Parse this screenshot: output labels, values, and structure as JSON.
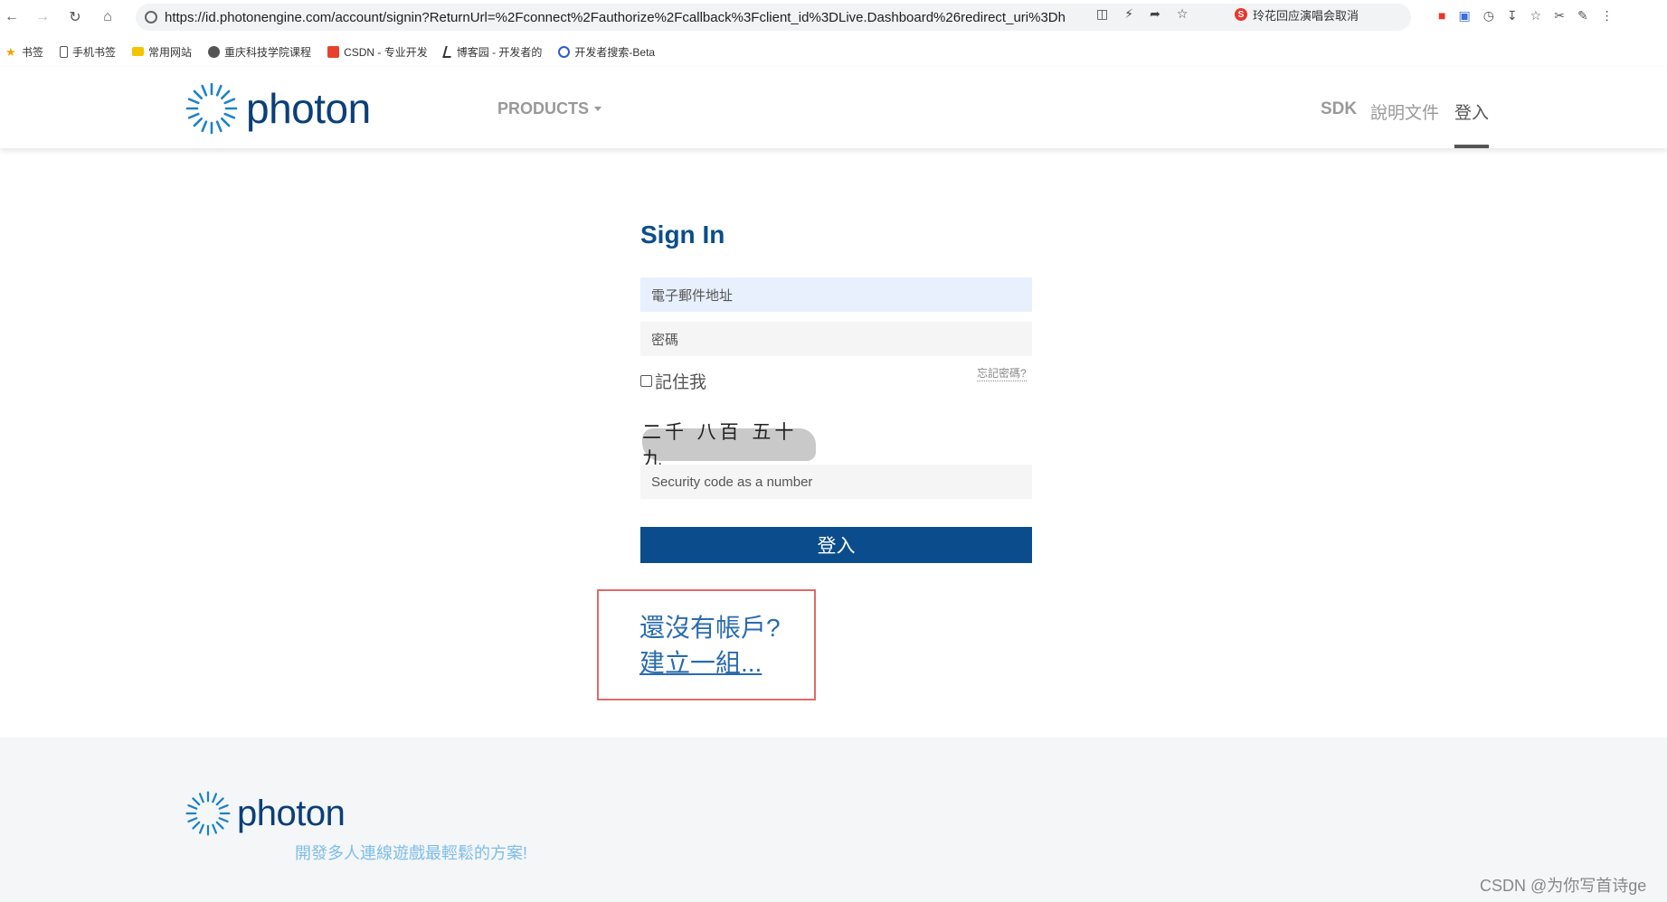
{
  "browser": {
    "url": "https://id.photonengine.com/account/signin?ReturnUrl=%2Fconnect%2Fauthorize%2Fcallback%3Fclient_id%3DLive.Dashboard%26redirect_uri%3Dh",
    "news_chip": "玲花回应演唱会取消",
    "bookmarks": [
      {
        "label": "书签",
        "icon": "star-icon"
      },
      {
        "label": "手机书签",
        "icon": "phone-icon"
      },
      {
        "label": "常用网站",
        "icon": "folder-icon"
      },
      {
        "label": "重庆科技学院课程",
        "icon": "globe-icon"
      },
      {
        "label": "CSDN - 专业开发",
        "icon": "csdn-icon"
      },
      {
        "label": "博客园 - 开发者的",
        "icon": "cnblogs-icon"
      },
      {
        "label": "开发者搜索-Beta",
        "icon": "search-beta-icon"
      }
    ]
  },
  "header": {
    "logo_text": "photon",
    "products_label": "PRODUCTS",
    "sdk_label": "SDK",
    "docs_label": "說明文件",
    "login_label": "登入"
  },
  "signin": {
    "title": "Sign In",
    "email_placeholder": "電子郵件地址",
    "password_placeholder": "密碼",
    "remember_label": "記住我",
    "forgot_label": "忘記密碼?",
    "captcha_text": "二千 八百 五十 九",
    "captcha_placeholder": "Security code as a number",
    "submit_label": "登入",
    "no_account_label": "還沒有帳戶?",
    "create_label": "建立一組..."
  },
  "footer": {
    "logo_text": "photon",
    "tagline": "開發多人連線遊戲最輕鬆的方案!",
    "watermark": "CSDN @为你写首诗ge"
  },
  "colors": {
    "brand_blue": "#0b4d8c",
    "link_blue": "#2a6bb0",
    "highlight_box": "#e06a6a",
    "tagline": "#7fbde6"
  }
}
